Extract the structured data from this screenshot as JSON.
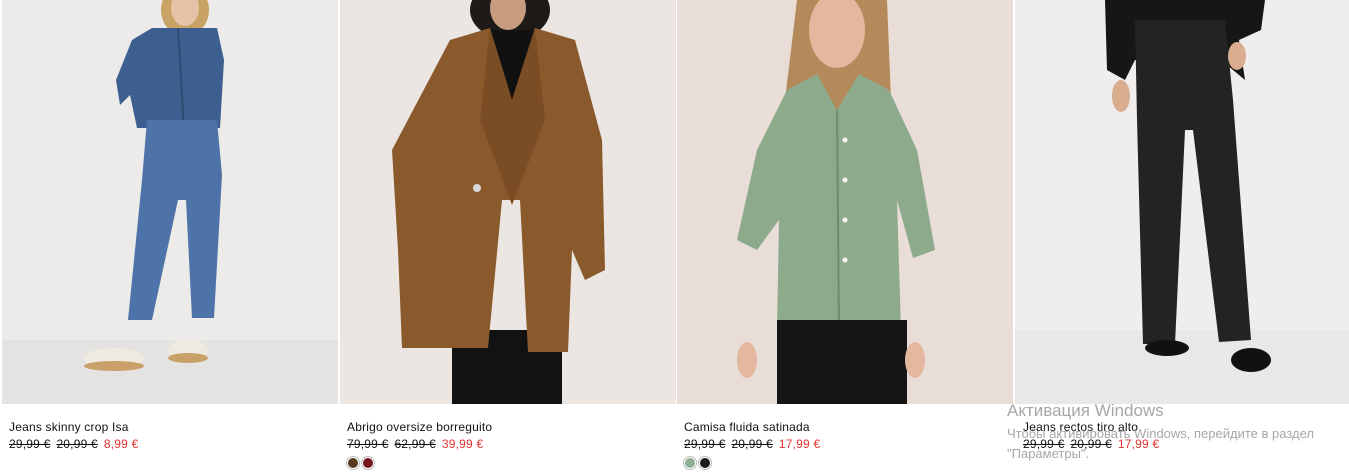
{
  "products": [
    {
      "name": "Jeans skinny crop Isa",
      "price_original": "29,99 €",
      "price_previous": "20,99 €",
      "price_sale": "8,99 €",
      "swatches": []
    },
    {
      "name": "Abrigo oversize borreguito",
      "price_original": "79,99 €",
      "price_previous": "62,99 €",
      "price_sale": "39,99 €",
      "swatches": [
        "#5a3a1f",
        "#7a1420"
      ]
    },
    {
      "name": "Camisa fluida satinada",
      "price_original": "29,99 €",
      "price_previous": "20,99 €",
      "price_sale": "17,99 €",
      "swatches": [
        "#8fae94",
        "#1c1c1c"
      ]
    },
    {
      "name": "Jeans rectos tiro alto",
      "price_original": "29,99 €",
      "price_previous": "20,99 €",
      "price_sale": "17,99 €",
      "swatches": []
    }
  ],
  "watermark": {
    "title": "Активация Windows",
    "text": "Чтобы активировать Windows, перейдите в раздел \"Параметры\"."
  },
  "colors": {
    "sale_price": "#e0332f",
    "text": "#111111"
  }
}
